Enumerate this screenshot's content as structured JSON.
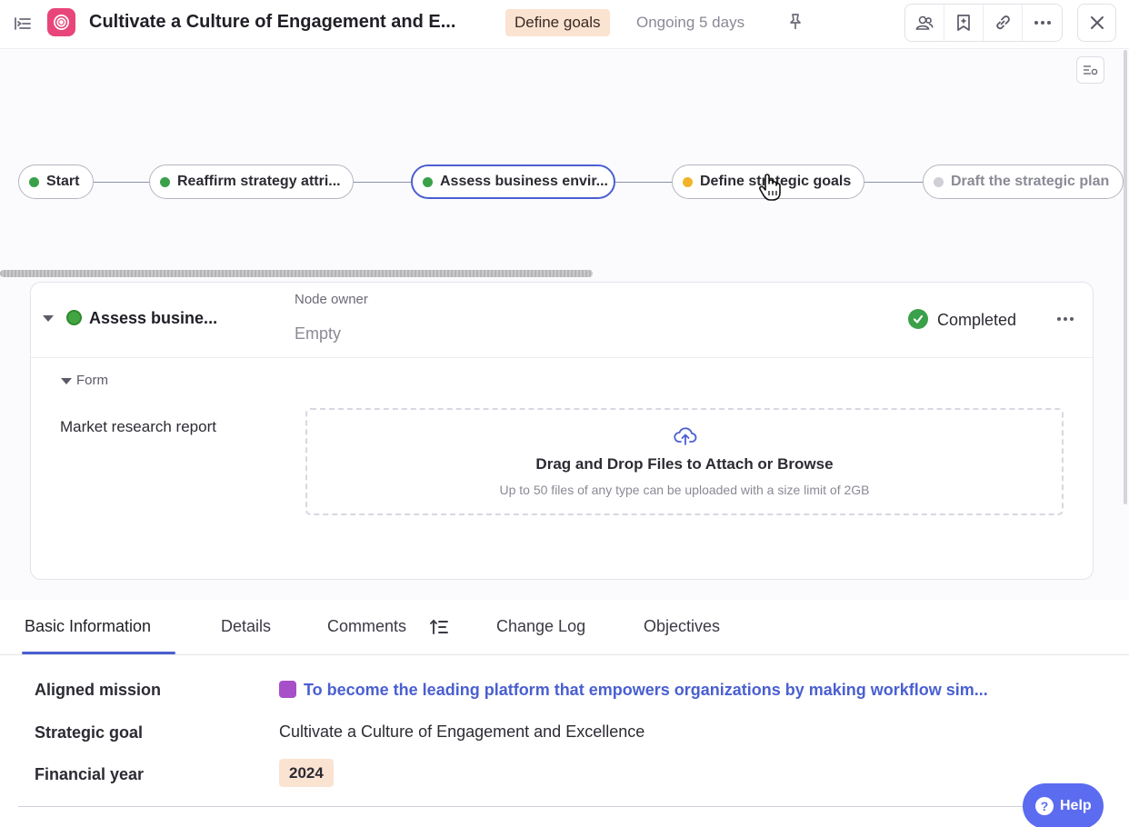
{
  "header": {
    "title": "Cultivate a Culture of Engagement and E...",
    "stage_badge": "Define goals",
    "status": "Ongoing 5 days",
    "icons": [
      "sidebar-toggle-icon",
      "target-icon",
      "pin-icon",
      "people-icon",
      "bookmark-icon",
      "link-icon",
      "more-icon",
      "close-icon"
    ],
    "badge_color": "#fbe3d2",
    "app_icon_color": "#e8457a"
  },
  "flow": {
    "nodes": [
      {
        "label": "Start",
        "status": "completed",
        "dot_color": "#3aa14a"
      },
      {
        "label": "Reaffirm strategy attri...",
        "status": "completed",
        "dot_color": "#3aa14a"
      },
      {
        "label": "Assess business envir...",
        "status": "completed",
        "dot_color": "#3aa14a",
        "selected": true
      },
      {
        "label": "Define strategic goals",
        "status": "in-progress",
        "dot_color": "#f0b429"
      },
      {
        "label": "Draft the strategic plan",
        "status": "pending",
        "dot_color": "#cfcfd6"
      }
    ],
    "accent": "#4a5fd1"
  },
  "node_panel": {
    "name": "Assess busine...",
    "owner_label": "Node owner",
    "owner_value": "Empty",
    "status": "Completed",
    "form_label": "Form",
    "field_label": "Market research report",
    "dropzone_title": "Drag and Drop Files to Attach or Browse",
    "dropzone_sub": "Up to 50 files of any type can be uploaded with a size limit of 2GB"
  },
  "tabs": [
    "Basic Information",
    "Details",
    "Comments",
    "Change Log",
    "Objectives"
  ],
  "info": {
    "aligned_mission_label": "Aligned mission",
    "aligned_mission_value": "To become the leading platform that empowers organizations by making workflow sim...",
    "strategic_goal_label": "Strategic goal",
    "strategic_goal_value": "Cultivate a Culture of Engagement and Excellence",
    "financial_year_label": "Financial year",
    "financial_year_value": "2024",
    "mission_color": "#a64fc9"
  },
  "help": {
    "label": "Help",
    "glyph": "?"
  }
}
